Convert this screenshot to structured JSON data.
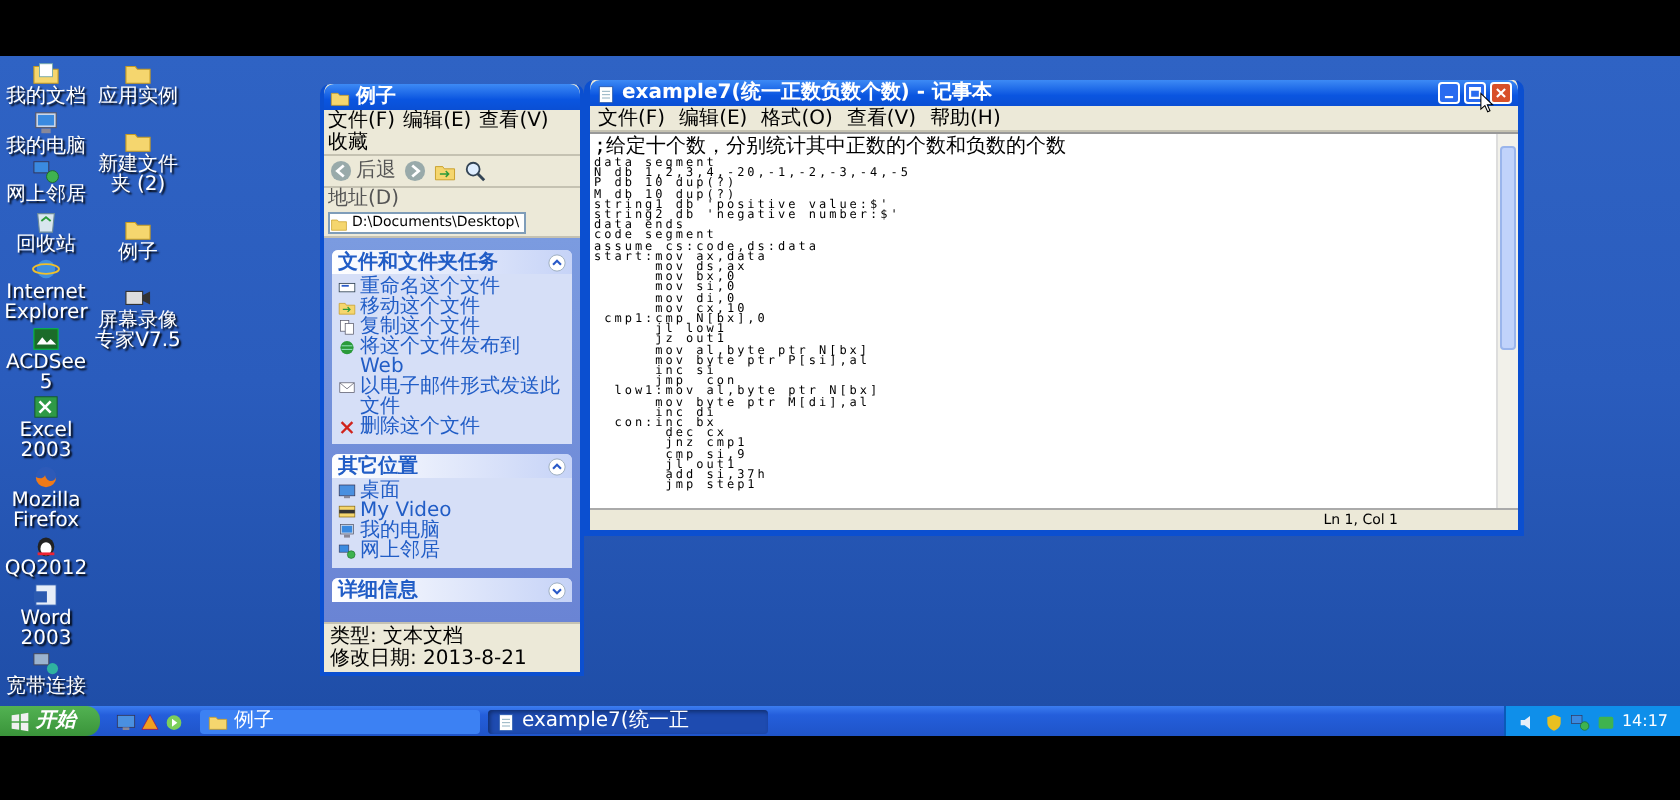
{
  "desktop": {
    "icons_column_1": [
      {
        "label": "我的文档",
        "kind": "documents"
      },
      {
        "label": "我的电脑",
        "kind": "computer"
      },
      {
        "label": "网上邻居",
        "kind": "network"
      },
      {
        "label": "回收站",
        "kind": "trash"
      },
      {
        "label": "Internet Explorer",
        "kind": "globe"
      },
      {
        "label": "ACDSee5",
        "kind": "viewer"
      },
      {
        "label": "Excel 2003",
        "kind": "sheet"
      },
      {
        "label": "Mozilla Firefox",
        "kind": "fox"
      },
      {
        "label": "QQ2012",
        "kind": "penguin"
      },
      {
        "label": "Word 2003",
        "kind": "word"
      },
      {
        "label": "宽带连接",
        "kind": "broadband"
      }
    ],
    "icons_column_2": [
      {
        "label": "应用实例",
        "kind": "folder"
      },
      {
        "label": "新建文件夹 (2)",
        "kind": "folder"
      },
      {
        "label": "例子",
        "kind": "folder"
      },
      {
        "label": "屏幕录像专家V7.5",
        "kind": "camera"
      }
    ]
  },
  "explorer_window": {
    "title": "例子",
    "menu": [
      "文件(F)",
      "编辑(E)",
      "查看(V)",
      "收藏"
    ],
    "back_label": "后退",
    "address_label": "地址(D)",
    "address": "D:\\Documents\\Desktop\\",
    "panels": [
      {
        "title": "文件和文件夹任务",
        "expanded": true,
        "items": [
          {
            "label": "重命名这个文件",
            "kind": "rename"
          },
          {
            "label": "移动这个文件",
            "kind": "move"
          },
          {
            "label": "复制这个文件",
            "kind": "copy"
          },
          {
            "label": "将这个文件发布到 Web",
            "kind": "web"
          },
          {
            "label": "以电子邮件形式发送此文件",
            "kind": "mail"
          },
          {
            "label": "删除这个文件",
            "kind": "delete"
          }
        ]
      },
      {
        "title": "其它位置",
        "expanded": true,
        "items": [
          {
            "label": "桌面",
            "kind": "desktop"
          },
          {
            "label": "My Video",
            "kind": "video"
          },
          {
            "label": "我的电脑",
            "kind": "computer"
          },
          {
            "label": "网上邻居",
            "kind": "network"
          }
        ]
      },
      {
        "title": "详细信息",
        "expanded": false
      }
    ],
    "status": [
      "类型: 文本文档",
      "修改日期: 2013-8-21"
    ]
  },
  "notepad_window": {
    "title": "example7(统一正数负数个数) - 记事本",
    "menu": [
      "文件(F)",
      "编辑(E)",
      "格式(O)",
      "查看(V)",
      "帮助(H)"
    ],
    "lines": [
      {
        "text": ";给定十个数，分别统计其中正数的个数和负数的个数",
        "kind": "comment"
      },
      {
        "text": "data segment",
        "kind": "code"
      },
      {
        "text": "N db 1,2,3,4,-20,-1,-2,-3,-4,-5",
        "kind": "code"
      },
      {
        "text": "P db 10 dup(?)",
        "kind": "code"
      },
      {
        "text": "M db 10 dup(?)",
        "kind": "code"
      },
      {
        "text": "string1 db 'positive value:$'",
        "kind": "code"
      },
      {
        "text": "string2 db 'negative number:$'",
        "kind": "code"
      },
      {
        "text": "data ends",
        "kind": "code"
      },
      {
        "text": "code segment",
        "kind": "code"
      },
      {
        "text": "assume cs:code,ds:data",
        "kind": "code"
      },
      {
        "text": "start:mov ax,data",
        "kind": "code"
      },
      {
        "text": "      mov ds,ax",
        "kind": "code"
      },
      {
        "text": "      mov bx,0",
        "kind": "code"
      },
      {
        "text": "      mov si,0",
        "kind": "code"
      },
      {
        "text": "      mov di,0",
        "kind": "code"
      },
      {
        "text": "      mov cx,10",
        "kind": "code"
      },
      {
        "text": " cmp1:cmp N[bx],0",
        "kind": "code"
      },
      {
        "text": "      jl low1",
        "kind": "code"
      },
      {
        "text": "      jz out1",
        "kind": "code"
      },
      {
        "text": "      mov al,byte ptr N[bx]",
        "kind": "code"
      },
      {
        "text": "      mov byte ptr P[si],al",
        "kind": "code"
      },
      {
        "text": "      inc si",
        "kind": "code"
      },
      {
        "text": "      jmp  con",
        "kind": "code"
      },
      {
        "text": "  low1:mov al,byte ptr N[bx]",
        "kind": "code"
      },
      {
        "text": "      mov byte ptr M[di],al",
        "kind": "code"
      },
      {
        "text": "      inc di",
        "kind": "code"
      },
      {
        "text": "  con:inc bx",
        "kind": "code"
      },
      {
        "text": "       dec cx",
        "kind": "code"
      },
      {
        "text": "       jnz cmp1",
        "kind": "code"
      },
      {
        "text": "       cmp si,9",
        "kind": "code"
      },
      {
        "text": "       jl out1",
        "kind": "code"
      },
      {
        "text": "       add si,37h",
        "kind": "code"
      },
      {
        "text": "       jmp step1",
        "kind": "code"
      }
    ],
    "status": "Ln 1, Col 1"
  },
  "taskbar": {
    "start": "开始",
    "quick_launch": [
      {
        "kind": "desktop"
      },
      {
        "kind": "warning"
      },
      {
        "kind": "media"
      }
    ],
    "tasks": [
      {
        "label": "例子",
        "kind": "folder",
        "selected": false
      },
      {
        "label": "example7(统一正",
        "kind": "notepad",
        "selected": true
      }
    ],
    "tray": [
      {
        "kind": "speaker"
      },
      {
        "kind": "shield"
      },
      {
        "kind": "network"
      },
      {
        "kind": "app"
      }
    ],
    "clock": "14:17"
  }
}
